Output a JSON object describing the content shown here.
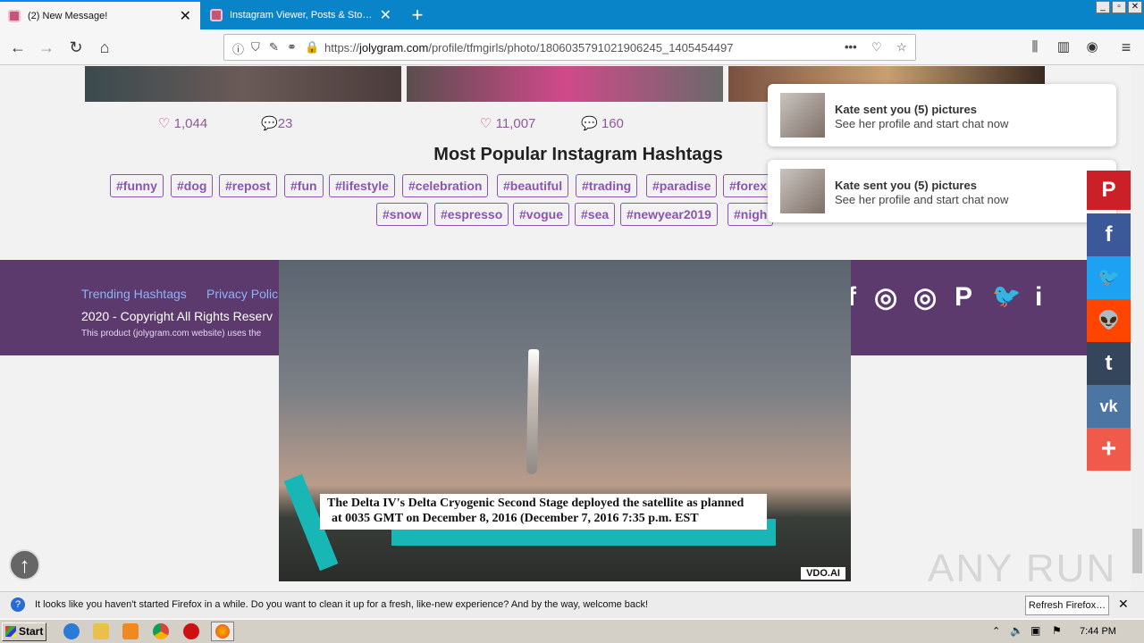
{
  "browser": {
    "tabs": [
      {
        "title": "(2) New Message!",
        "close": "✕"
      },
      {
        "title": "Instagram Viewer, Posts & Story D",
        "close": "✕"
      }
    ],
    "new_tab": "+",
    "window_controls": [
      "_",
      "▫",
      "✕"
    ],
    "url_prefix": "https://",
    "url_domain": "jolygram.com",
    "url_path": "/profile/tfmgirls/photo/1806035791021906245_1405454497"
  },
  "posts": [
    {
      "likes": "1,044",
      "comments": "23"
    },
    {
      "likes": "11,007",
      "comments": "160"
    }
  ],
  "hashtags_title": "Most Popular Instagram Hashtags",
  "hashtags": [
    "#funny",
    "#dog",
    "#repost",
    "#fun",
    "#lifestyle",
    "#celebration",
    "#beautiful",
    "#trading",
    "#paradise",
    "#forex",
    "#snow",
    "#espresso",
    "#vogue",
    "#sea",
    "#newyear2019",
    "#nigh"
  ],
  "footer": {
    "links": [
      "Trending Hashtags",
      "Privacy Polic"
    ],
    "copyright": "2020 - Copyright All Rights Reserv",
    "notice": "This product (jolygram.com website) uses the"
  },
  "video": {
    "caption_line1": "The Delta IV's Delta Cryogenic Second Stage deployed the satellite as planned",
    "caption_line2": "at 0035 GMT on December 8, 2016 (December 7, 2016 7:35 p.m. EST",
    "brand": "VDO.AI"
  },
  "notifications": [
    {
      "title": "Kate sent you (5) pictures",
      "subtitle": "See her profile and start chat now"
    },
    {
      "title": "Kate sent you (5) pictures",
      "subtitle": "See her profile and start chat now"
    }
  ],
  "share_buttons": [
    {
      "name": "pinterest",
      "glyph": "P",
      "color": "#cb2027"
    },
    {
      "name": "facebook",
      "glyph": "f",
      "color": "#3b5998"
    },
    {
      "name": "twitter",
      "glyph": "🐦",
      "color": "#1da1f2"
    },
    {
      "name": "reddit",
      "glyph": "👽",
      "color": "#ff4500"
    },
    {
      "name": "tumblr",
      "glyph": "t",
      "color": "#35465c"
    },
    {
      "name": "vk",
      "glyph": "vk",
      "color": "#4c75a3"
    },
    {
      "name": "more",
      "glyph": "+",
      "color": "#f05a4a"
    }
  ],
  "footer_social": [
    "f",
    "◎",
    "◎",
    "P",
    "🐦",
    "i"
  ],
  "infobar": {
    "message": "It looks like you haven't started Firefox in a while. Do you want to clean it up for a fresh, like-new experience? And by the way, welcome back!",
    "button": "Refresh Firefox…"
  },
  "watermark": "ANY RUN",
  "taskbar": {
    "start": "Start",
    "clock": "7:44 PM"
  }
}
